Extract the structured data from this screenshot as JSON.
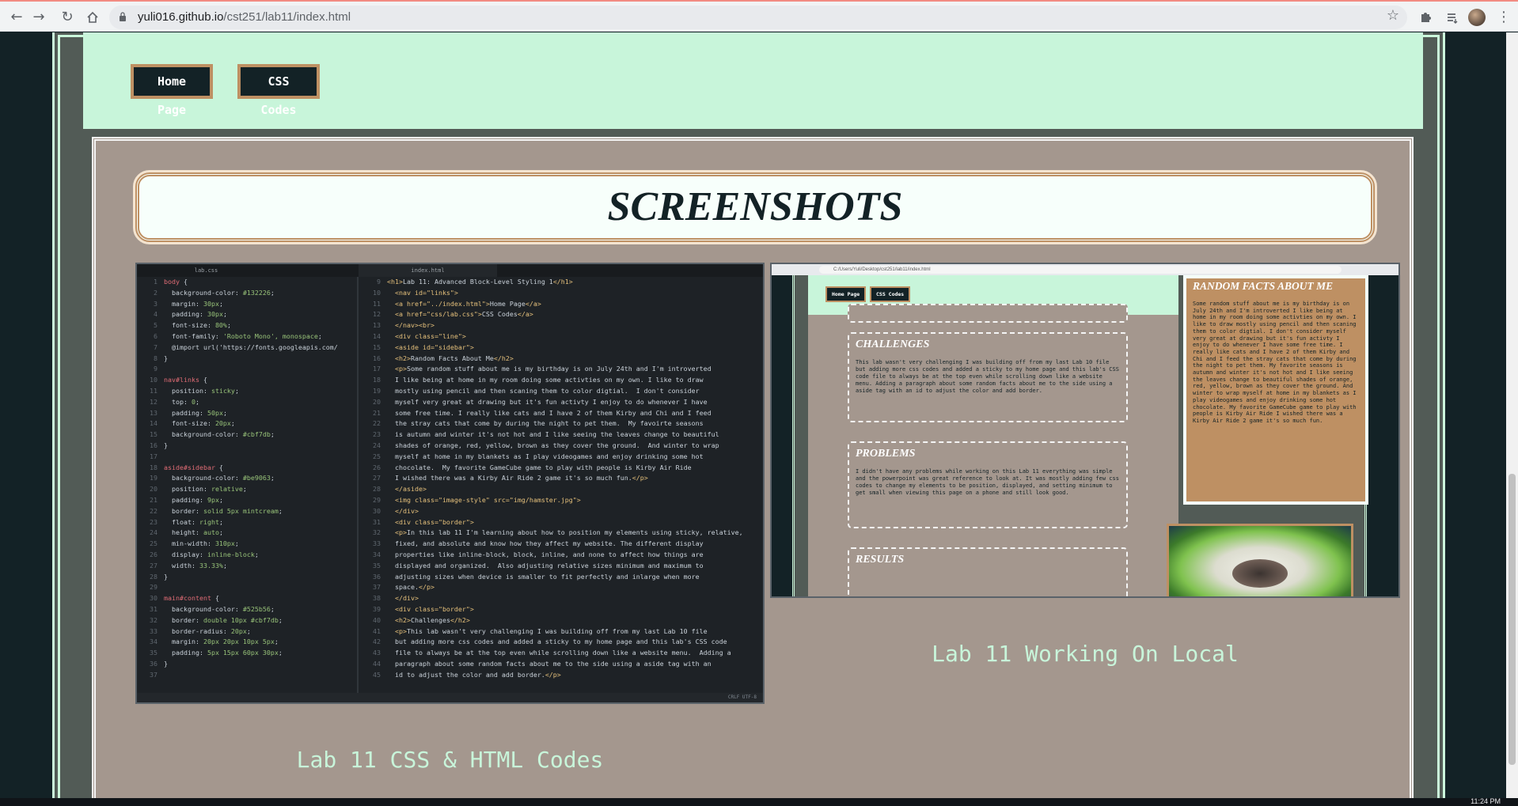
{
  "browser": {
    "url_host": "yuli016.github.io",
    "url_path": "/cst251/lab11/index.html",
    "back_icon": "arrow-left-icon",
    "forward_icon": "arrow-right-icon",
    "reload_icon": "reload-icon",
    "home_icon": "home-icon",
    "bookmark_icon": "star-icon",
    "extensions_icon": "puzzle-icon",
    "menu_icon": "kebab-menu-icon"
  },
  "nav": {
    "home_label": "Home Page",
    "css_label": "CSS Codes"
  },
  "section": {
    "title": "SCREENSHOTS"
  },
  "captions": {
    "left": "Lab 11 CSS & HTML Codes",
    "right": "Lab 11 Working On Local"
  },
  "editor": {
    "tab_css": "lab.css",
    "tab_html": "index.html",
    "status": "CRLF   UTF-8"
  },
  "mini_browser": {
    "url": "C:/Users/Yuli/Desktop/cst251/lab11/index.html",
    "home_label": "Home Page",
    "css_label": "CSS Codes",
    "challenges_title": "CHALLENGES",
    "challenges_text": "This lab wasn't very challenging I was building off from my last Lab 10 file but adding more css codes and added a sticky to my home page and this lab's CSS code file to always be at the top even while scrolling down like a website menu. Adding a paragraph about some random facts about me to the side using a aside tag with an id to adjust the color and add border.",
    "problems_title": "PROBLEMS",
    "problems_text": "I didn't have any problems while working on this Lab 11 everything was simple and the powerpoint was great reference to look at. It was mostly adding few css codes to change my elements to be position, displayed, and setting minimum to get small when viewing this page on a phone and still look good.",
    "results_title": "RESULTS",
    "aside_title": "RANDOM FACTS ABOUT ME",
    "aside_text": "Some random stuff about me is my birthday is on July 24th and I'm introverted I like being at home in my room doing some activties on my own. I like to draw mostly using pencil and then scaning them to color digtial. I don't consider myself very great at drawing but it's fun activty I enjoy to do whenever I have some free time. I really like cats and I have 2 of them Kirby and Chi and I feed the stray cats that come by during the night to pet them. My favorite seasons is autumn and winter it's not hot and I like seeing the leaves change to beautiful shades of orange, red, yellow, brown as they cover the ground. And winter to wrap myself at home in my blankets as I play videogames and enjoy drinking some hot chocolate. My favorite GameCube game to play with people is Kirby Air Ride I wished there was a Kirby Air Ride 2 game it's so much fun."
  },
  "taskbar": {
    "clock": "11:24 PM"
  }
}
